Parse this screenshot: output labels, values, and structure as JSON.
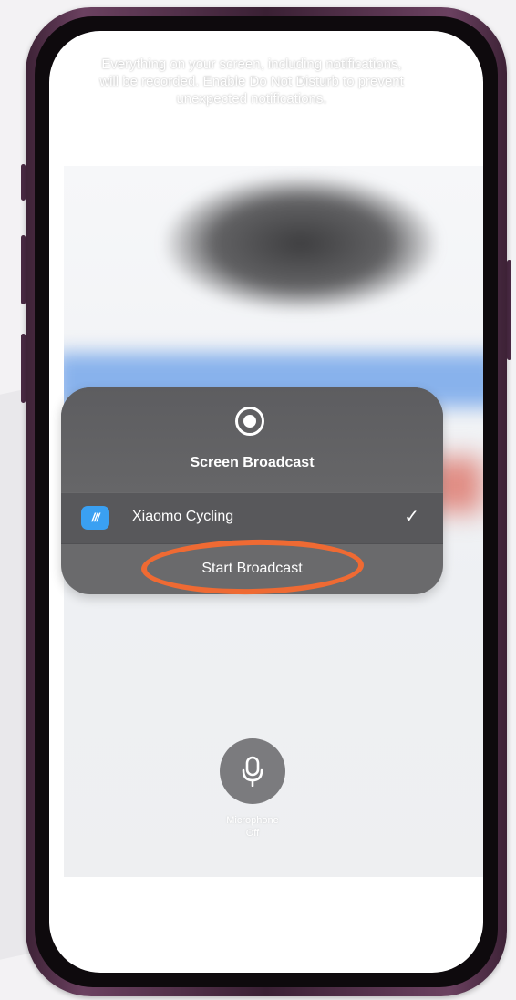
{
  "notice": {
    "line1": "Everything on your screen, including notifications,",
    "line2": "will be recorded. Enable Do Not Disturb to prevent",
    "line3": "unexpected notifications."
  },
  "panel": {
    "title": "Screen Broadcast",
    "icon": "record-icon",
    "app": {
      "name": "Xiaomo Cycling",
      "icon_text": "///",
      "icon_color": "#3aa0f2",
      "selected": true,
      "check": "✓"
    },
    "start_label": "Start Broadcast"
  },
  "annotation": {
    "color": "#ef6a33"
  },
  "microphone": {
    "icon": "microphone-icon",
    "label_line1": "Microphone",
    "label_line2": "Off"
  }
}
